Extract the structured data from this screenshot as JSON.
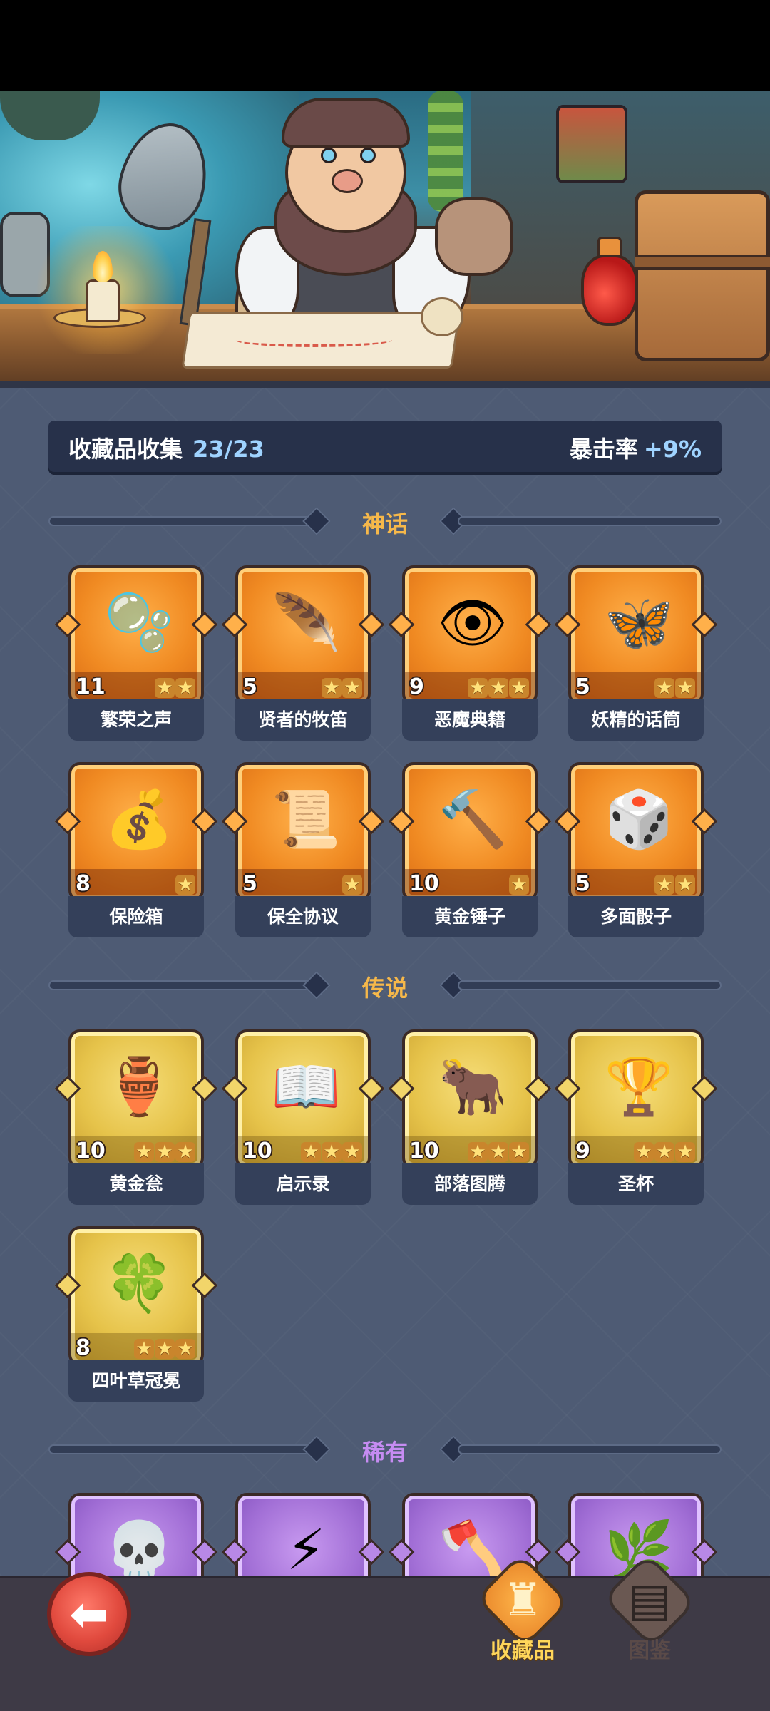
{
  "summary": {
    "label": "收藏品收集",
    "count": "23/23",
    "stat_label": "暴击率",
    "stat_value": "+9%"
  },
  "sections": {
    "mythic": {
      "title": "神话",
      "color": "#f6b84a",
      "items": [
        {
          "name": "繁荣之声",
          "level": "11",
          "stars": 2,
          "icon": "spirit-orb-icon",
          "glyph": "🫧"
        },
        {
          "name": "贤者的牧笛",
          "level": "5",
          "stars": 2,
          "icon": "feather-flute-icon",
          "glyph": "🪶"
        },
        {
          "name": "恶魔典籍",
          "level": "9",
          "stars": 3,
          "icon": "demon-tome-icon",
          "glyph": "👁"
        },
        {
          "name": "妖精的话筒",
          "level": "5",
          "stars": 2,
          "icon": "fairy-microphone-icon",
          "glyph": "🦋"
        },
        {
          "name": "保险箱",
          "level": "8",
          "stars": 1,
          "icon": "treasure-chest-icon",
          "glyph": "💰"
        },
        {
          "name": "保全协议",
          "level": "5",
          "stars": 1,
          "icon": "contract-scroll-icon",
          "glyph": "📜"
        },
        {
          "name": "黄金锤子",
          "level": "10",
          "stars": 1,
          "icon": "golden-hammer-icon",
          "glyph": "🔨"
        },
        {
          "name": "多面骰子",
          "level": "5",
          "stars": 2,
          "icon": "polyhedral-dice-icon",
          "glyph": "🎲"
        }
      ]
    },
    "legend": {
      "title": "传说",
      "color": "#f6b84a",
      "items": [
        {
          "name": "黄金瓮",
          "level": "10",
          "stars": 3,
          "icon": "golden-urn-icon",
          "glyph": "🏺"
        },
        {
          "name": "启示录",
          "level": "10",
          "stars": 3,
          "icon": "revelation-book-icon",
          "glyph": "📖"
        },
        {
          "name": "部落图腾",
          "level": "10",
          "stars": 3,
          "icon": "tribal-totem-icon",
          "glyph": "🐂"
        },
        {
          "name": "圣杯",
          "level": "9",
          "stars": 3,
          "icon": "holy-grail-icon",
          "glyph": "🏆"
        },
        {
          "name": "四叶草冠冕",
          "level": "8",
          "stars": 3,
          "icon": "clover-crown-icon",
          "glyph": "🍀"
        }
      ]
    },
    "rare": {
      "title": "稀有",
      "color": "#c68cf2",
      "items": [
        {
          "icon": "skull-staff-icon",
          "glyph": "💀"
        },
        {
          "icon": "lightning-card-icon",
          "glyph": "⚡"
        },
        {
          "icon": "axe-icon",
          "glyph": "🪓"
        },
        {
          "icon": "vine-icon",
          "glyph": "🌿"
        }
      ]
    }
  },
  "nav": {
    "back_icon": "back-arrow-icon",
    "tabs": [
      {
        "label": "收藏品",
        "icon": "collection-lyre-icon",
        "active": true
      },
      {
        "label": "图鉴",
        "icon": "codex-book-icon",
        "active": false
      }
    ]
  },
  "colors": {
    "accent": "#9fd3ff",
    "background": "#4e5b74",
    "mythic_frame": "#f08a22",
    "legend_frame": "#e6c34a",
    "rare_frame": "#a26fd6"
  }
}
